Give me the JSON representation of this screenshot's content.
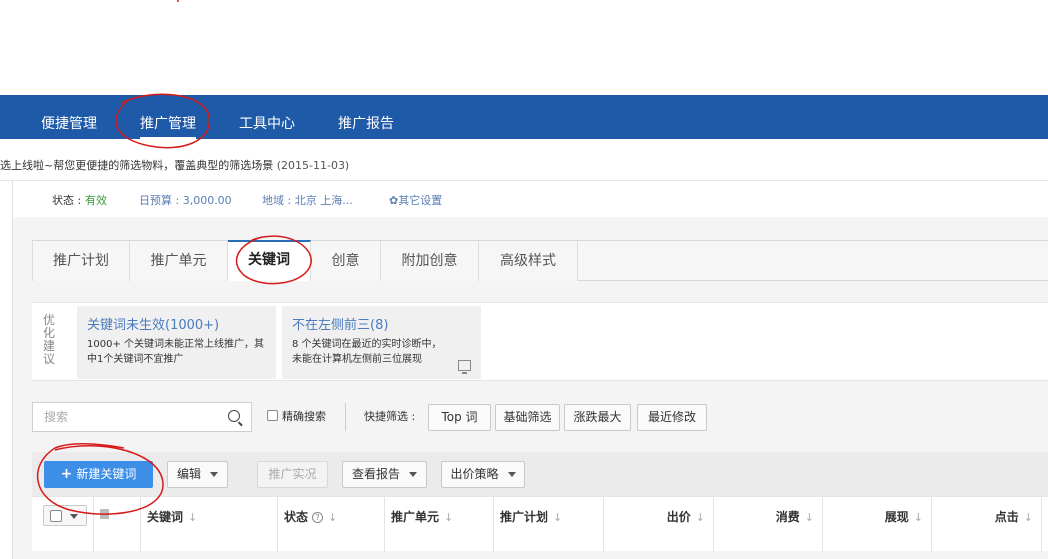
{
  "topnav": {
    "items": [
      {
        "label": "便捷管理"
      },
      {
        "label": "推广管理"
      },
      {
        "label": "工具中心"
      },
      {
        "label": "推广报告"
      }
    ]
  },
  "notice": {
    "text": "选上线啦~帮您更便捷的筛选物料，覆盖典型的筛选场景",
    "date": "(2015-11-03)"
  },
  "status": {
    "label": "状态 :",
    "value": "有效",
    "budget": "日预算 : 3,000.00",
    "region": "地域 : 北京 上海...",
    "settings_icon": "gear-icon",
    "settings": "其它设置"
  },
  "tabs": [
    {
      "label": "推广计划"
    },
    {
      "label": "推广单元"
    },
    {
      "label": "关键词"
    },
    {
      "label": "创意"
    },
    {
      "label": "附加创意"
    },
    {
      "label": "高级样式"
    }
  ],
  "optimize": {
    "label_chars": [
      "优",
      "化",
      "建",
      "议"
    ],
    "cards": [
      {
        "title": "关键词未生效(1000+)",
        "desc": "1000+ 个关键词未能正常上线推广，其中1个关键词不宜推广"
      },
      {
        "title": "不在左侧前三(8)",
        "desc": "8 个关键词在最近的实时诊断中，未能在计算机左侧前三位展现"
      }
    ],
    "card_icon": "monitor-icon"
  },
  "search": {
    "placeholder": "搜索",
    "exact_label": "精确搜索",
    "quick_label": "快捷筛选 :",
    "quick_buttons": [
      "Top 词",
      "基础筛选",
      "涨跌最大",
      "最近修改"
    ]
  },
  "toolbar": {
    "new_keyword": "新建关键词",
    "new_keyword_icon": "+",
    "edit": "编辑",
    "live_preview": "推广实况",
    "view_report": "查看报告",
    "bid_strategy": "出价策略"
  },
  "table": {
    "sort_glyph": "↓",
    "help_glyph": "?",
    "columns": [
      "关键词",
      "状态",
      "推广单元",
      "推广计划",
      "出价",
      "消费",
      "展现",
      "点击"
    ]
  },
  "colors": {
    "nav_bg": "#1f5aa8",
    "accent": "#3d8ee6",
    "status_valid": "#3a9a3a",
    "link_blue": "#4a7bc0",
    "annotation_red": "#d61a1a"
  }
}
